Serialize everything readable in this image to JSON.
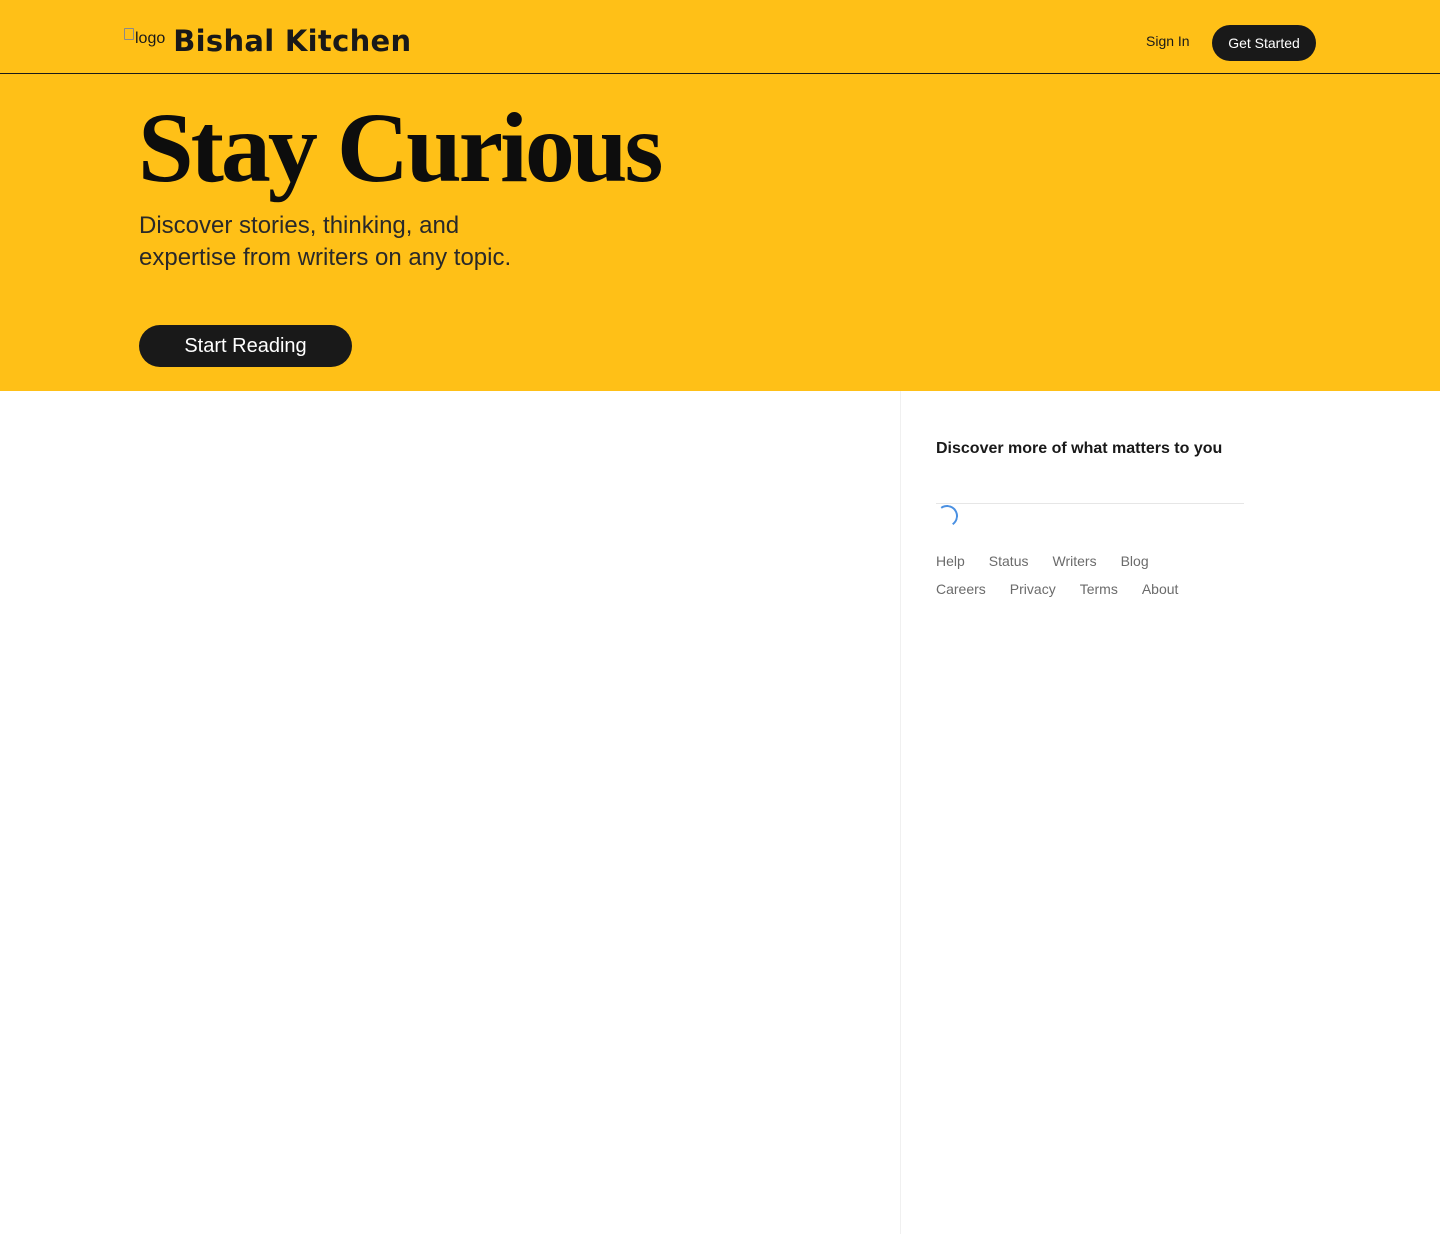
{
  "header": {
    "logo_alt": "logo",
    "brand": "Bishal Kitchen",
    "sign_in": "Sign In",
    "get_started": "Get Started"
  },
  "hero": {
    "title": "Stay Curious",
    "subtitle": "Discover stories, thinking, and expertise from writers on any topic.",
    "cta": "Start Reading"
  },
  "sidebar": {
    "heading": "Discover more of what matters to you",
    "footer_row1": [
      "Help",
      "Status",
      "Writers",
      "Blog"
    ],
    "footer_row2": [
      "Careers",
      "Privacy",
      "Terms",
      "About"
    ]
  },
  "colors": {
    "brand_yellow": "#ffc017",
    "dark": "#191919",
    "spinner": "#4a90e2"
  }
}
